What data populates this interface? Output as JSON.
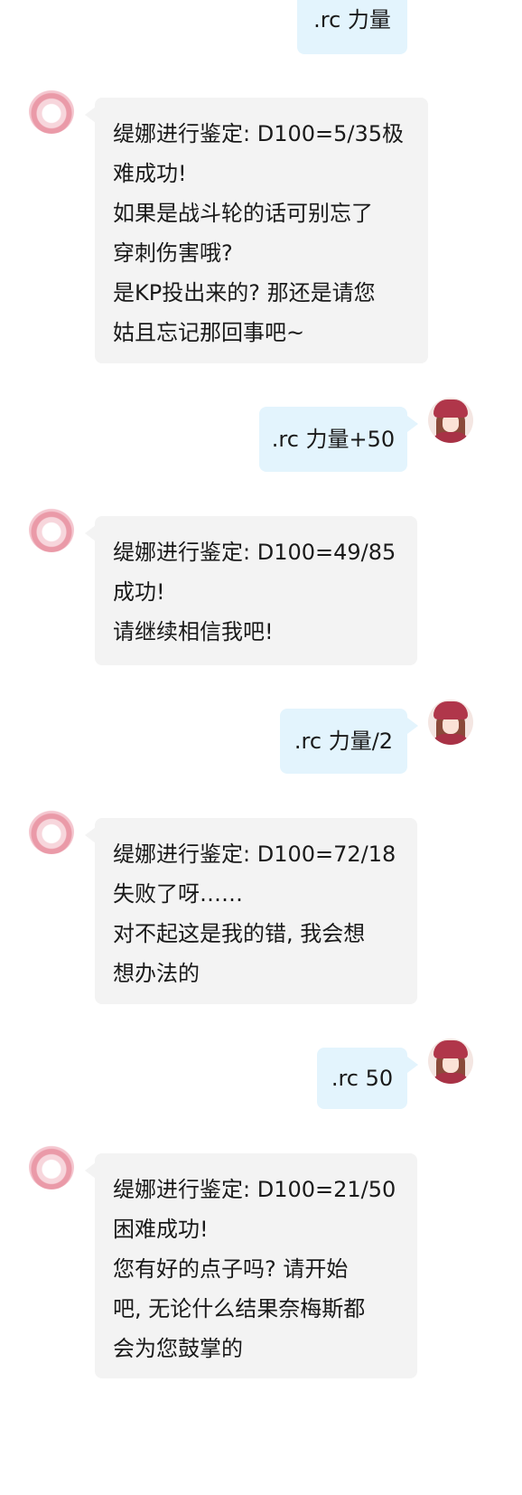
{
  "messages": [
    {
      "from": "user",
      "lines": [
        ".rc 力量"
      ]
    },
    {
      "from": "bot",
      "lines": [
        "缇娜进行鉴定: D100=5/35极",
        "难成功!",
        "如果是战斗轮的话可别忘了",
        "穿刺伤害哦?",
        "是KP投出来的? 那还是请您",
        "姑且忘记那回事吧~"
      ]
    },
    {
      "from": "user",
      "lines": [
        ".rc 力量+50"
      ]
    },
    {
      "from": "bot",
      "lines": [
        "缇娜进行鉴定: D100=49/85",
        "成功!",
        "请继续相信我吧!"
      ]
    },
    {
      "from": "user",
      "lines": [
        ".rc 力量/2"
      ]
    },
    {
      "from": "bot",
      "lines": [
        "缇娜进行鉴定: D100=72/18",
        "失败了呀……",
        "对不起这是我的错, 我会想",
        "想办法的"
      ]
    },
    {
      "from": "user",
      "lines": [
        ".rc 50"
      ]
    },
    {
      "from": "bot",
      "lines": [
        "缇娜进行鉴定: D100=21/50",
        "困难成功!",
        "您有好的点子吗? 请开始",
        "吧, 无论什么结果奈梅斯都",
        "会为您鼓掌的"
      ]
    }
  ],
  "colors": {
    "user_bubble": "#e3f4fd",
    "bot_bubble": "#f3f3f3",
    "background": "#ffffff"
  },
  "icons": {
    "bot_avatar": "pink-ring-avatar-icon",
    "user_avatar": "girl-red-beret-avatar-icon"
  }
}
